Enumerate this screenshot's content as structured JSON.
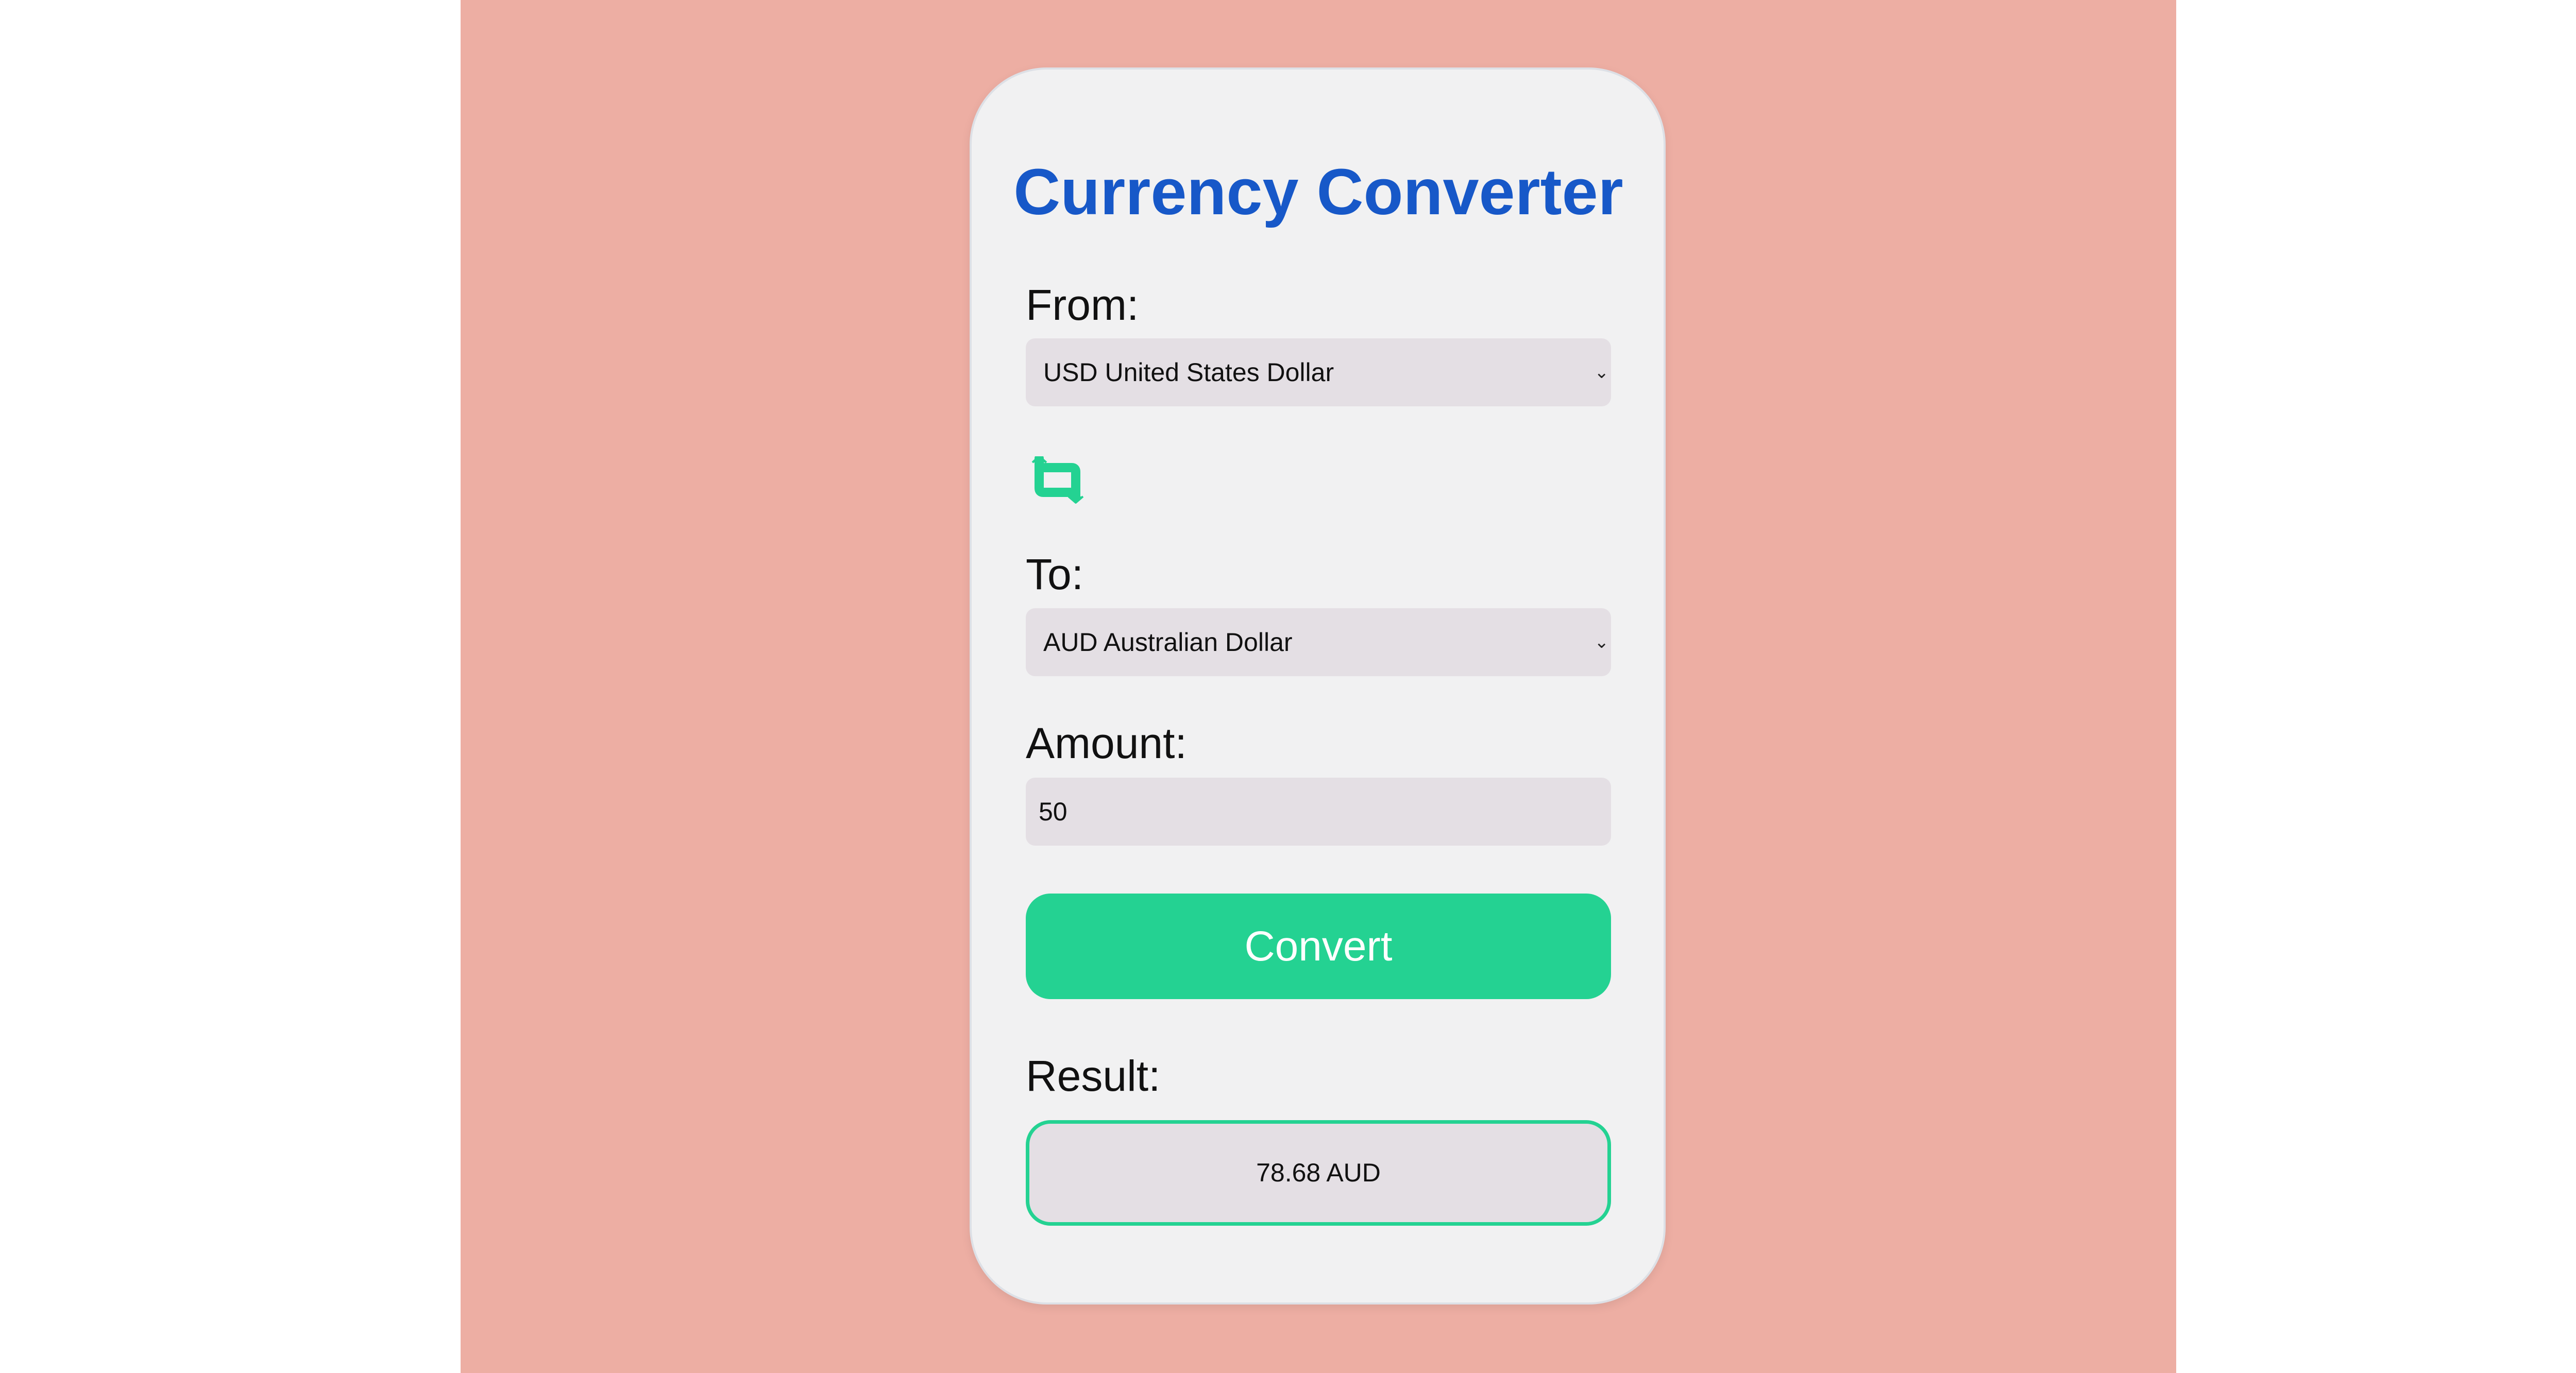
{
  "app": {
    "title": "Currency Converter"
  },
  "form": {
    "from_label": "From:",
    "from_value": "USD United States Dollar",
    "to_label": "To:",
    "to_value": "AUD Australian Dollar",
    "amount_label": "Amount:",
    "amount_value": "50",
    "convert_label": "Convert",
    "result_label": "Result:",
    "result_value": "78.68 AUD"
  },
  "icons": {
    "swap": "swap-arrows-icon",
    "select": "chevron-down-icon"
  },
  "colors": {
    "background": "#edaea3",
    "card": "#f1f1f2",
    "title": "#1758c8",
    "accent": "#24d292",
    "field": "#e4dfe4",
    "outer_background": "#ffffff"
  }
}
